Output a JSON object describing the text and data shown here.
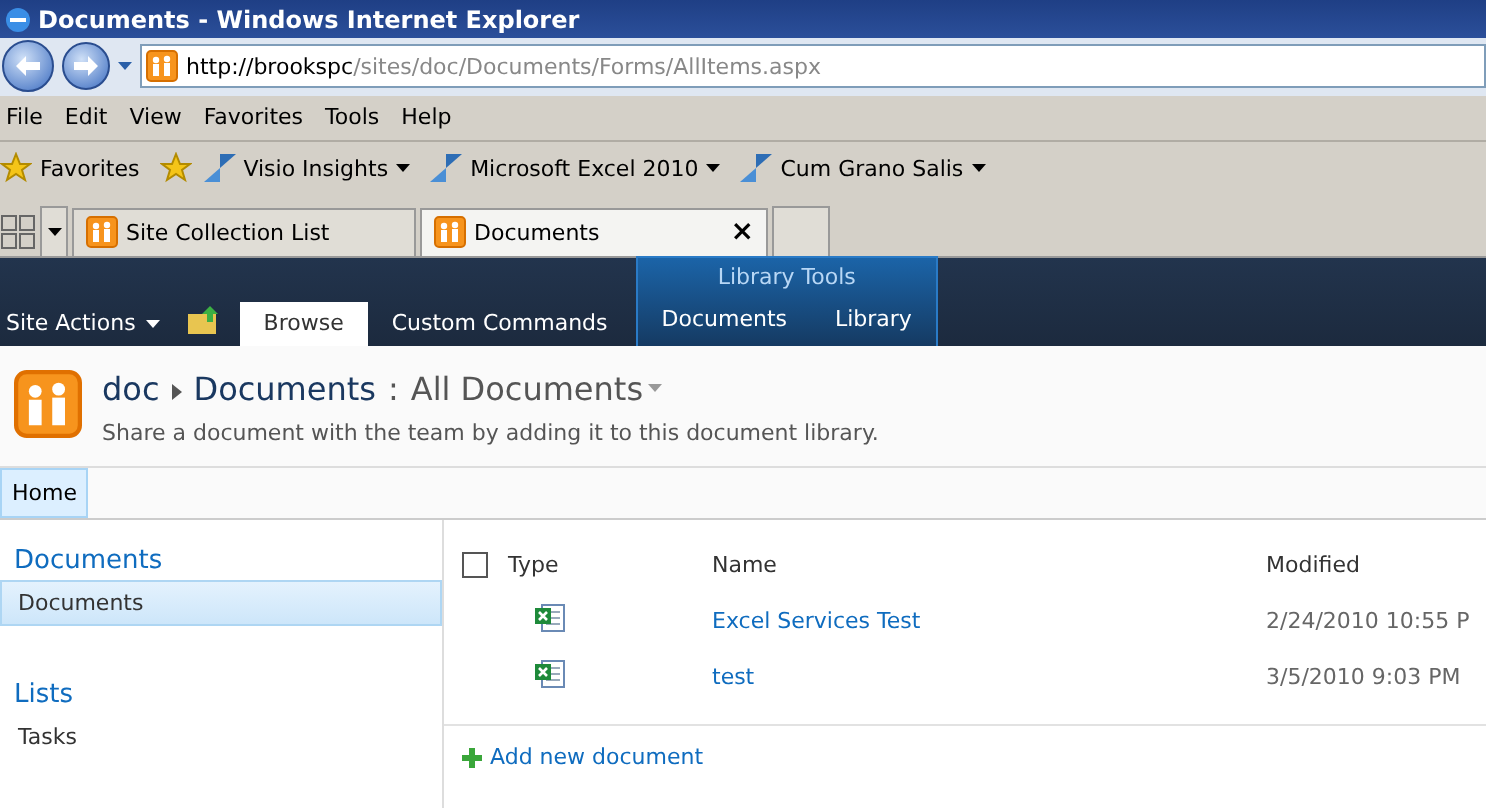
{
  "window": {
    "title": "Documents - Windows Internet Explorer"
  },
  "address": {
    "value_host": "http://brookspc",
    "value_path": "/sites/doc/Documents/Forms/AllItems.aspx"
  },
  "menu": [
    "File",
    "Edit",
    "View",
    "Favorites",
    "Tools",
    "Help"
  ],
  "favorites": {
    "label": "Favorites",
    "links": [
      "Visio Insights",
      "Microsoft Excel 2010",
      "Cum Grano Salis"
    ]
  },
  "browser_tabs": [
    {
      "label": "Site Collection List",
      "selected": false
    },
    {
      "label": "Documents",
      "selected": true,
      "close": "×"
    }
  ],
  "ribbon": {
    "site_actions": "Site Actions",
    "tabs": [
      {
        "label": "Browse",
        "selected": true
      },
      {
        "label": "Custom Commands",
        "selected": false
      }
    ],
    "contextual_group": {
      "title": "Library Tools",
      "tabs": [
        {
          "label": "Documents",
          "selected": false
        },
        {
          "label": "Library",
          "selected": false
        }
      ]
    }
  },
  "header": {
    "site": "doc",
    "separator": ":",
    "library": "Documents",
    "view": "All Documents",
    "description": "Share a document with the team by adding it to this document library."
  },
  "top_nav": [
    {
      "label": "Home",
      "selected": true
    }
  ],
  "quick_launch": [
    {
      "heading": "Documents",
      "items": [
        {
          "label": "Documents",
          "selected": true
        }
      ]
    },
    {
      "heading": "Lists",
      "items": [
        {
          "label": "Tasks",
          "selected": false
        }
      ]
    }
  ],
  "table": {
    "columns": [
      "Type",
      "Name",
      "Modified"
    ],
    "select_all": false,
    "rows": [
      {
        "name": "Excel Services Test",
        "modified": "2/24/2010 10:55 P"
      },
      {
        "name": "test",
        "modified": "3/5/2010 9:03 PM"
      }
    ],
    "add_link": "Add new document"
  }
}
